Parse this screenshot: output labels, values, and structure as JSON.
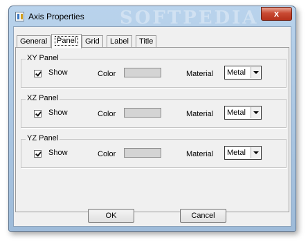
{
  "window": {
    "title": "Axis Properties",
    "watermark": "SOFTPEDIA",
    "close_glyph": "x"
  },
  "tabs": [
    {
      "label": "General"
    },
    {
      "label": "Panel"
    },
    {
      "label": "Grid"
    },
    {
      "label": "Label"
    },
    {
      "label": "Title"
    }
  ],
  "panels": [
    {
      "legend": "XY Panel",
      "show_label": "Show",
      "show_checked": true,
      "color_label": "Color",
      "color": "#d4d4d4",
      "material_label": "Material",
      "material": "Metal"
    },
    {
      "legend": "XZ Panel",
      "show_label": "Show",
      "show_checked": true,
      "color_label": "Color",
      "color": "#d4d4d4",
      "material_label": "Material",
      "material": "Metal"
    },
    {
      "legend": "YZ Panel",
      "show_label": "Show",
      "show_checked": true,
      "color_label": "Color",
      "color": "#d4d4d4",
      "material_label": "Material",
      "material": "Metal"
    }
  ],
  "buttons": {
    "ok": "OK",
    "cancel": "Cancel"
  }
}
